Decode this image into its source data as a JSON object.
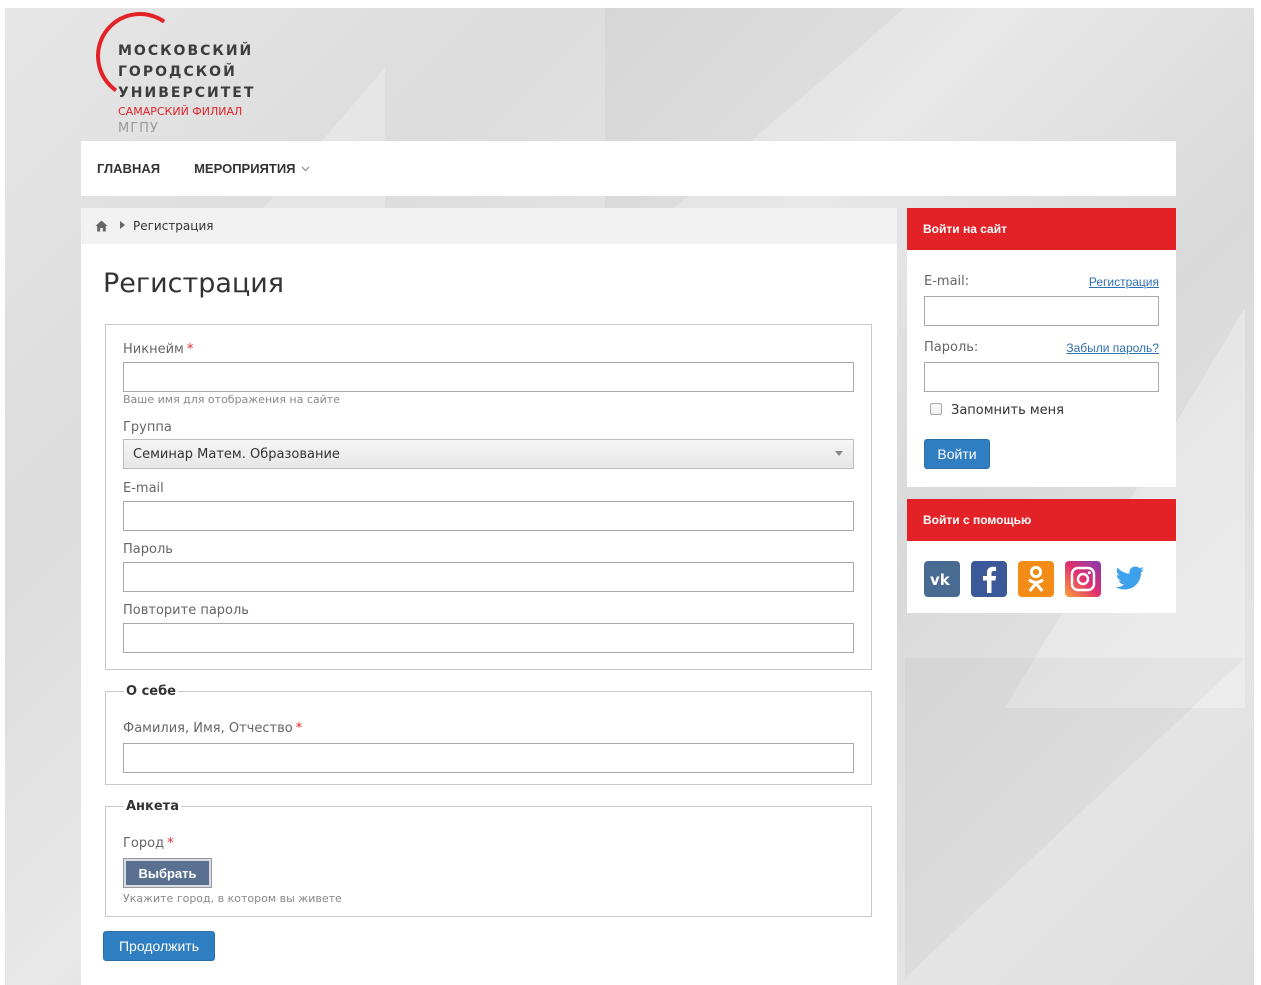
{
  "logo": {
    "line1": "МОСКОВСКИЙ",
    "line2": "ГОРОДСКОЙ",
    "line3": "УНИВЕРСИТЕТ",
    "line4": "САМАРСКИЙ ФИЛИАЛ",
    "line5": "МГПУ"
  },
  "nav": {
    "items": [
      {
        "label": "ГЛАВНАЯ"
      },
      {
        "label": "МЕРОПРИЯТИЯ"
      }
    ]
  },
  "breadcrumb": {
    "current": "Регистрация"
  },
  "page": {
    "title": "Регистрация"
  },
  "form": {
    "account": {
      "nickname_label": "Никнейм",
      "nickname_value": "",
      "nickname_hint": "Ваше имя для отображения на сайте",
      "group_label": "Группа",
      "group_selected": "Семинар Матем. Образование",
      "email_label": "E-mail",
      "email_value": "",
      "password_label": "Пароль",
      "password_value": "",
      "password_repeat_label": "Повторите пароль",
      "password_repeat_value": ""
    },
    "about": {
      "legend": "О себе",
      "fullname_label": "Фамилия, Имя, Отчество",
      "fullname_value": ""
    },
    "survey": {
      "legend": "Анкета",
      "city_label": "Город",
      "city_button": "Выбрать",
      "city_hint": "Укажите город, в котором вы живете"
    },
    "required_mark": "*",
    "submit_label": "Продолжить"
  },
  "login_panel": {
    "title": "Войти на сайт",
    "email_label": "E-mail:",
    "register_link": "Регистрация",
    "password_label": "Пароль:",
    "forgot_link": "Забыли пароль?",
    "remember_label": "Запомнить меня",
    "remember_checked": false,
    "submit_label": "Войти"
  },
  "social_panel": {
    "title": "Войти с помощью",
    "networks": [
      {
        "icon": "vk-icon",
        "color": "#4a6b91"
      },
      {
        "icon": "facebook-icon",
        "color": "#3b5998"
      },
      {
        "icon": "odnoklassniki-icon",
        "color": "#f28c17"
      },
      {
        "icon": "instagram-icon",
        "color": "#c13584"
      },
      {
        "icon": "twitter-icon",
        "color": "#3ea1ec"
      }
    ]
  },
  "colors": {
    "accent_red": "#e32228",
    "primary_blue": "#2f7ec1",
    "link_blue": "#2f6fb3"
  }
}
